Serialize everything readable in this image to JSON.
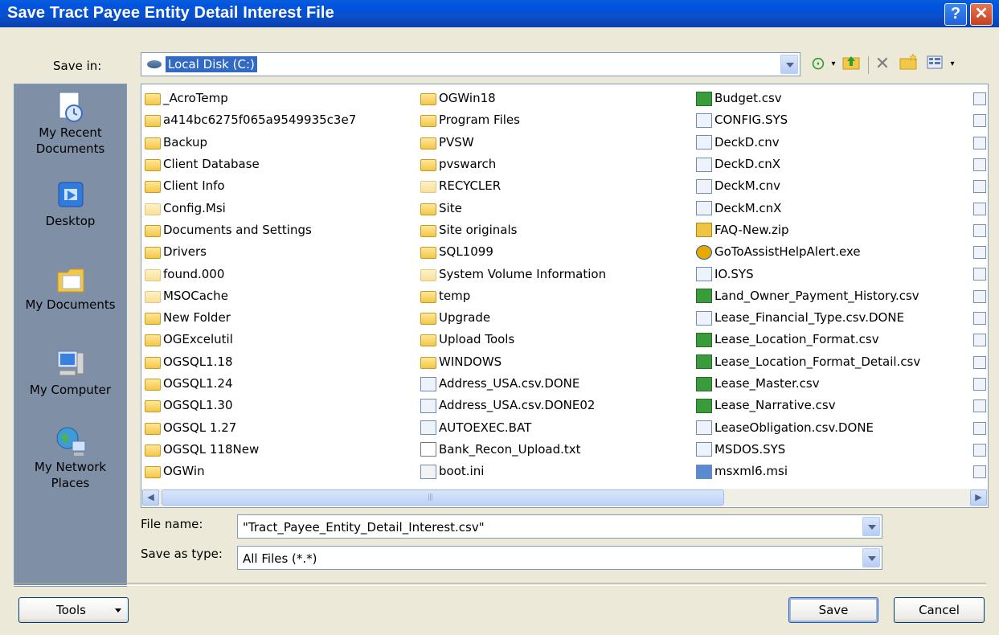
{
  "window": {
    "title": "Save Tract Payee Entity Detail Interest File",
    "help_glyph": "?",
    "close_glyph": "✕"
  },
  "toolbar": {
    "save_in_label": "Save in:",
    "location": "Local Disk (C:)",
    "icons": [
      "back-icon",
      "up-folder-icon",
      "delete-icon",
      "new-folder-icon",
      "views-menu-icon"
    ]
  },
  "places": [
    {
      "label": "My Recent\nDocuments",
      "icon": "recent-documents-icon"
    },
    {
      "label": "Desktop",
      "icon": "desktop-icon"
    },
    {
      "label": "My Documents",
      "icon": "my-documents-icon"
    },
    {
      "label": "My Computer",
      "icon": "my-computer-icon"
    },
    {
      "label": "My Network\nPlaces",
      "icon": "network-places-icon"
    }
  ],
  "files": {
    "column1": [
      {
        "name": "_AcroTemp",
        "type": "folder"
      },
      {
        "name": "a414bc6275f065a9549935c3e7",
        "type": "folder"
      },
      {
        "name": "Backup",
        "type": "folder"
      },
      {
        "name": "Client Database",
        "type": "folder"
      },
      {
        "name": "Client Info",
        "type": "folder"
      },
      {
        "name": "Config.Msi",
        "type": "folder-hidden"
      },
      {
        "name": "Documents and Settings",
        "type": "folder"
      },
      {
        "name": "Drivers",
        "type": "folder"
      },
      {
        "name": "found.000",
        "type": "folder-hidden"
      },
      {
        "name": "MSOCache",
        "type": "folder-hidden"
      },
      {
        "name": "New Folder",
        "type": "folder"
      },
      {
        "name": "OGExcelutil",
        "type": "folder"
      },
      {
        "name": "OGSQL1.18",
        "type": "folder"
      },
      {
        "name": "OGSQL1.24",
        "type": "folder"
      },
      {
        "name": "OGSQL1.30",
        "type": "folder"
      },
      {
        "name": "OGSQL 1.27",
        "type": "folder"
      },
      {
        "name": "OGSQL 118New",
        "type": "folder"
      },
      {
        "name": "OGWin",
        "type": "folder"
      }
    ],
    "column2": [
      {
        "name": "OGWin18",
        "type": "folder"
      },
      {
        "name": "Program Files",
        "type": "folder"
      },
      {
        "name": "PVSW",
        "type": "folder"
      },
      {
        "name": "pvswarch",
        "type": "folder"
      },
      {
        "name": "RECYCLER",
        "type": "folder-hidden"
      },
      {
        "name": "Site",
        "type": "folder"
      },
      {
        "name": "Site originals",
        "type": "folder"
      },
      {
        "name": "SQL1099",
        "type": "folder"
      },
      {
        "name": "System Volume Information",
        "type": "folder-hidden"
      },
      {
        "name": "temp",
        "type": "folder"
      },
      {
        "name": "Upgrade",
        "type": "folder"
      },
      {
        "name": "Upload Tools",
        "type": "folder"
      },
      {
        "name": "WINDOWS",
        "type": "folder"
      },
      {
        "name": "Address_USA.csv.DONE",
        "type": "file"
      },
      {
        "name": "Address_USA.csv.DONE02",
        "type": "file"
      },
      {
        "name": "AUTOEXEC.BAT",
        "type": "file"
      },
      {
        "name": "Bank_Recon_Upload.txt",
        "type": "txt"
      },
      {
        "name": "boot.ini",
        "type": "ini"
      }
    ],
    "column3": [
      {
        "name": "Budget.csv",
        "type": "csv"
      },
      {
        "name": "CONFIG.SYS",
        "type": "file"
      },
      {
        "name": "DeckD.cnv",
        "type": "file"
      },
      {
        "name": "DeckD.cnX",
        "type": "file"
      },
      {
        "name": "DeckM.cnv",
        "type": "file"
      },
      {
        "name": "DeckM.cnX",
        "type": "file"
      },
      {
        "name": "FAQ-New.zip",
        "type": "zip"
      },
      {
        "name": "GoToAssistHelpAlert.exe",
        "type": "exe"
      },
      {
        "name": "IO.SYS",
        "type": "file"
      },
      {
        "name": "Land_Owner_Payment_History.csv",
        "type": "csv"
      },
      {
        "name": "Lease_Financial_Type.csv.DONE",
        "type": "file"
      },
      {
        "name": "Lease_Location_Format.csv",
        "type": "csv"
      },
      {
        "name": "Lease_Location_Format_Detail.csv",
        "type": "csv"
      },
      {
        "name": "Lease_Master.csv",
        "type": "csv"
      },
      {
        "name": "Lease_Narrative.csv",
        "type": "csv"
      },
      {
        "name": "LeaseObligation.csv.DONE",
        "type": "file"
      },
      {
        "name": "MSDOS.SYS",
        "type": "file"
      },
      {
        "name": "msxml6.msi",
        "type": "msi"
      }
    ]
  },
  "form": {
    "file_name_label": "File name:",
    "file_name_value": "\"Tract_Payee_Entity_Detail_Interest.csv\"",
    "save_as_type_label": "Save as type:",
    "save_as_type_value": "All Files (*.*)"
  },
  "buttons": {
    "tools": "Tools",
    "save": "Save",
    "cancel": "Cancel"
  }
}
